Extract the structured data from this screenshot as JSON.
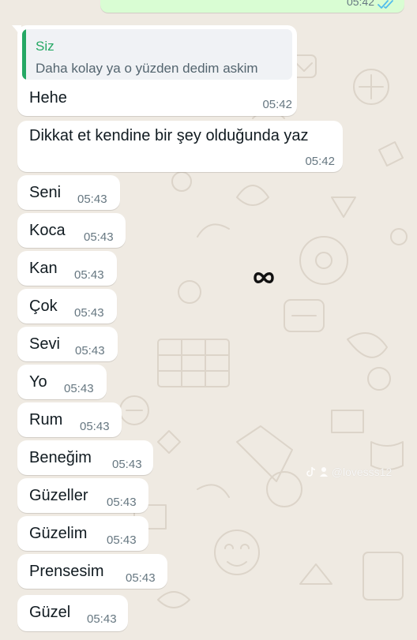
{
  "top_outgoing": {
    "time": "05:42",
    "status_icon": "double-check-read-icon",
    "status_color": "#53bdeb"
  },
  "reply": {
    "quoted_author": "Siz",
    "quoted_text": "Daha kolay ya o yüzden dedim askim",
    "text": "Hehe",
    "time": "05:42"
  },
  "messages": [
    {
      "text": "Dikkat et kendine bir şey olduğunda yaz",
      "time": "05:42"
    },
    {
      "text": "Seni",
      "time": "05:43"
    },
    {
      "text": "Koca",
      "time": "05:43"
    },
    {
      "text": "Kan",
      "time": "05:43"
    },
    {
      "text": "Çok",
      "time": "05:43"
    },
    {
      "text": "Sevi",
      "time": "05:43"
    },
    {
      "text": "Yo",
      "time": "05:43"
    },
    {
      "text": "Rum",
      "time": "05:43"
    },
    {
      "text": "Beneğim",
      "time": "05:43"
    },
    {
      "text": "Güzeller",
      "time": "05:43"
    },
    {
      "text": "Güzelim",
      "time": "05:43"
    },
    {
      "text": "Prensesim",
      "time": "05:43"
    },
    {
      "text": "Güzel",
      "time": "05:43"
    }
  ],
  "watermark": {
    "text": "@lovesss12",
    "icon": "tiktok-icon"
  },
  "overlay_icon": "infinity-icon",
  "colors": {
    "chat_background": "#efeae2",
    "incoming_bubble": "#ffffff",
    "outgoing_bubble": "#d9fdd3",
    "quote_accent": "#25a864",
    "timestamp": "#667781"
  }
}
